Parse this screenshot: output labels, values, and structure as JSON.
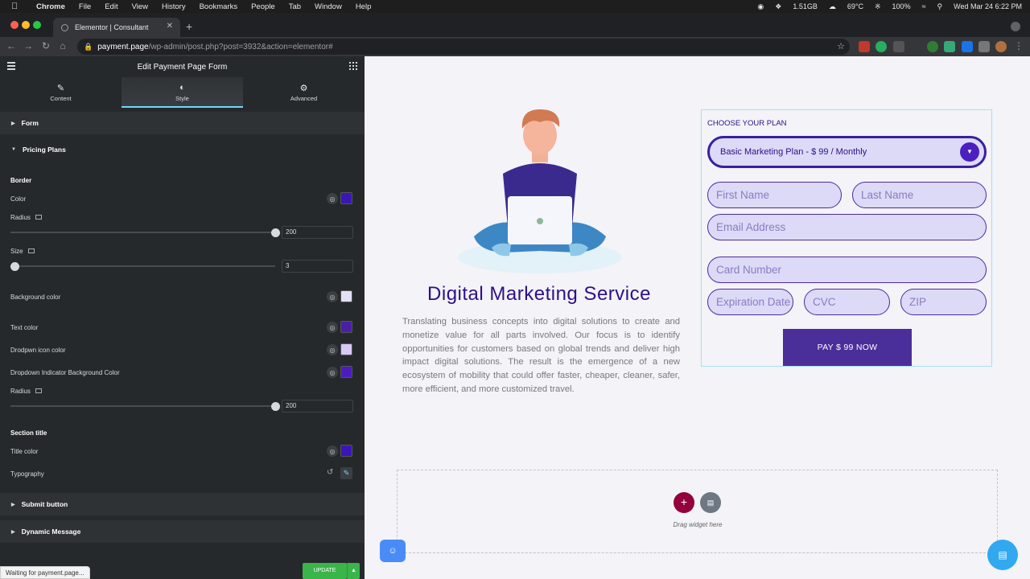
{
  "menubar": {
    "app": "Chrome",
    "items": [
      "File",
      "Edit",
      "View",
      "History",
      "Bookmarks",
      "People",
      "Tab",
      "Window",
      "Help"
    ],
    "memory": "1.51GB",
    "temp": "69°C",
    "battery": "100%",
    "datetime": "Wed Mar 24  6:22 PM"
  },
  "browser": {
    "tab_title": "Elementor | Consultant",
    "url_host": "payment.page",
    "url_path": "/wp-admin/post.php?post=3932&action=elementor#",
    "status": "Waiting for payment.page..."
  },
  "panel": {
    "title": "Edit Payment Page Form",
    "tabs": [
      {
        "label": "Content",
        "icon": "pencil-icon"
      },
      {
        "label": "Style",
        "icon": "contrast-icon"
      },
      {
        "label": "Advanced",
        "icon": "gear-icon"
      }
    ],
    "sections": {
      "form": "Form",
      "pricing_plans": "Pricing Plans",
      "submit_button": "Submit button",
      "dynamic_message": "Dynamic Message"
    },
    "controls": {
      "border_heading": "Border",
      "color": "Color",
      "radius": "Radius",
      "radius_value": "200",
      "size": "Size",
      "size_value": "3",
      "background_color": "Background color",
      "text_color": "Text color",
      "dropdown_icon_color": "Drodpwn icon color",
      "dropdown_indicator_bg": "Dropdown Indicator Background Color",
      "radius2": "Radius",
      "radius2_value": "200",
      "section_title_heading": "Section title",
      "title_color": "Title color",
      "typography": "Typography"
    },
    "swatches": {
      "color": "#3a16b8",
      "background": "#e2e0f8",
      "text": "#4a1fa8",
      "dropdown_icon": "#d8c8f5",
      "dropdown_indicator": "#4c1cc0",
      "title": "#3a16b8"
    },
    "update_label": "UPDATE"
  },
  "preview": {
    "heading": "Digital Marketing Service",
    "description": "Translating business concepts into digital solutions to create and monetize value for all parts involved. Our focus is to identify opportunities for customers based on global trends and deliver high impact digital solutions. The result is the emergence of a new ecosystem of mobility that could offer faster, cheaper, cleaner, safer, more efficient, and more customized travel.",
    "form": {
      "choose_label": "CHOOSE YOUR PLAN",
      "plan_selected": "Basic Marketing Plan - $ 99 / Monthly",
      "first_name": "First Name",
      "last_name": "Last Name",
      "email": "Email Address",
      "card_number": "Card Number",
      "expiration": "Expiration Date",
      "cvc": "CVC",
      "zip": "ZIP",
      "pay_button": "PAY $ 99 NOW"
    },
    "dropzone_text": "Drag widget here"
  }
}
